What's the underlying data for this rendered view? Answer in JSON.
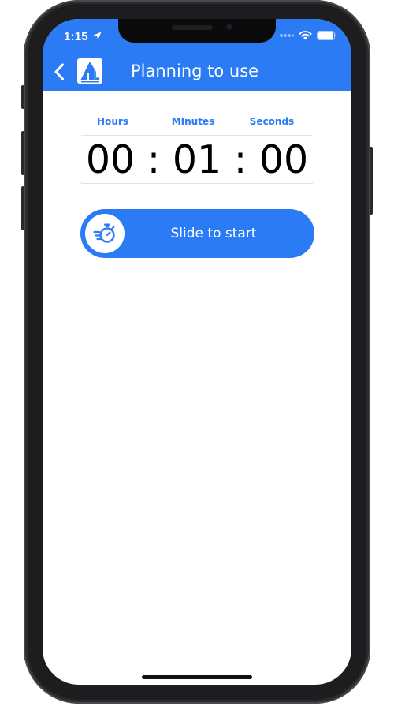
{
  "status_bar": {
    "time": "1:15",
    "icons": [
      "location-arrow-icon",
      "signal-dots-icon",
      "wifi-icon",
      "battery-icon"
    ]
  },
  "header": {
    "back_icon": "chevron-left-icon",
    "logo_icon": "app-logo-icon",
    "title": "Planning to use"
  },
  "timer": {
    "labels": {
      "hours": "Hours",
      "minutes": "MInutes",
      "seconds": "Seconds"
    },
    "display": "00 : 01 : 00",
    "hours": "00",
    "minutes": "01",
    "seconds": "00"
  },
  "slider": {
    "label": "Slide to start",
    "knob_icon": "stopwatch-icon"
  },
  "colors": {
    "accent": "#2a7bf4",
    "background": "#ffffff",
    "timer_text": "#000000"
  }
}
